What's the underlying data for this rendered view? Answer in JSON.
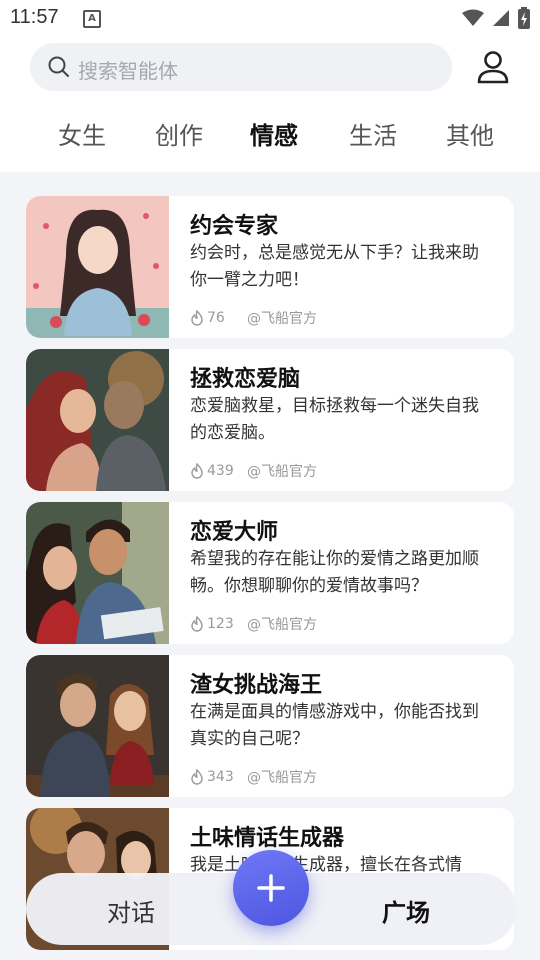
{
  "status": {
    "time": "11:57",
    "app_badge": "A"
  },
  "search": {
    "placeholder": "搜索智能体"
  },
  "tabs": [
    {
      "label": "女生"
    },
    {
      "label": "创作"
    },
    {
      "label": "情感",
      "active": true
    },
    {
      "label": "生活"
    },
    {
      "label": "其他"
    }
  ],
  "cards": [
    {
      "title": "约会专家",
      "desc": "约会时，总是感觉无从下手？让我来助你一臂之力吧！",
      "count": "76",
      "author": "@飞船官方"
    },
    {
      "title": "拯救恋爱脑",
      "desc": "恋爱脑救星，目标拯救每一个迷失自我的恋爱脑。",
      "count": "439",
      "author": "@飞船官方"
    },
    {
      "title": "恋爱大师",
      "desc": "希望我的存在能让你的爱情之路更加顺畅。你想聊聊你的爱情故事吗？",
      "count": "123",
      "author": "@飞船官方"
    },
    {
      "title": "渣女挑战海王",
      "desc": "在满是面具的情感游戏中，你能否找到真实的自己呢？",
      "count": "343",
      "author": "@飞船官方"
    },
    {
      "title": "土味情话生成器",
      "desc": "我是土味情话生成器，擅长在各式情"
    }
  ],
  "bottom_nav": {
    "left": "对话",
    "right": "广场"
  },
  "colors": {
    "accent": "#b9f06a",
    "fab": "#5a63e8"
  }
}
